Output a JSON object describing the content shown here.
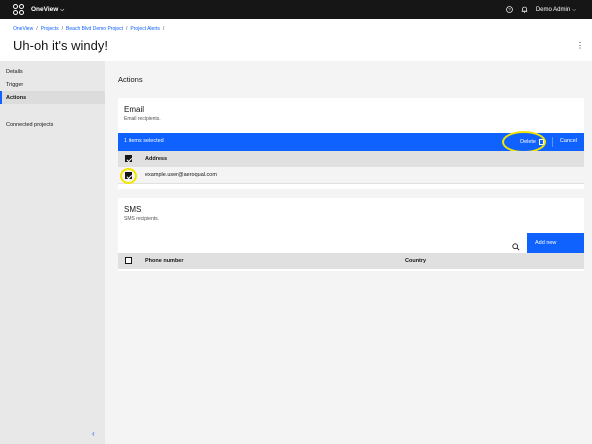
{
  "topbar": {
    "brand": "OneView",
    "user": "Demo Admin"
  },
  "breadcrumb": [
    "OneView",
    "Projects",
    "Beach Blvd Demo Project",
    "Project Alerts"
  ],
  "page_title": "Uh-oh it's windy!",
  "sidebar": {
    "items": [
      {
        "label": "Details"
      },
      {
        "label": "Trigger"
      },
      {
        "label": "Actions"
      }
    ],
    "connected_projects": "Connected projects"
  },
  "main": {
    "section_title": "Actions",
    "email": {
      "title": "Email",
      "subtitle": "Email recipients.",
      "batch": {
        "count_label": "1 items selected",
        "delete_label": "Delete",
        "cancel_label": "Cancel"
      },
      "columns": [
        "Address"
      ],
      "rows": [
        {
          "address": "example.user@aeroqual.com",
          "selected": true
        }
      ]
    },
    "sms": {
      "title": "SMS",
      "subtitle": "SMS recipients.",
      "add_label": "Add new",
      "columns": [
        "Phone number",
        "Country"
      ]
    }
  },
  "colors": {
    "primary": "#0f62fe",
    "topbar": "#161616",
    "highlight": "#f1e600"
  }
}
